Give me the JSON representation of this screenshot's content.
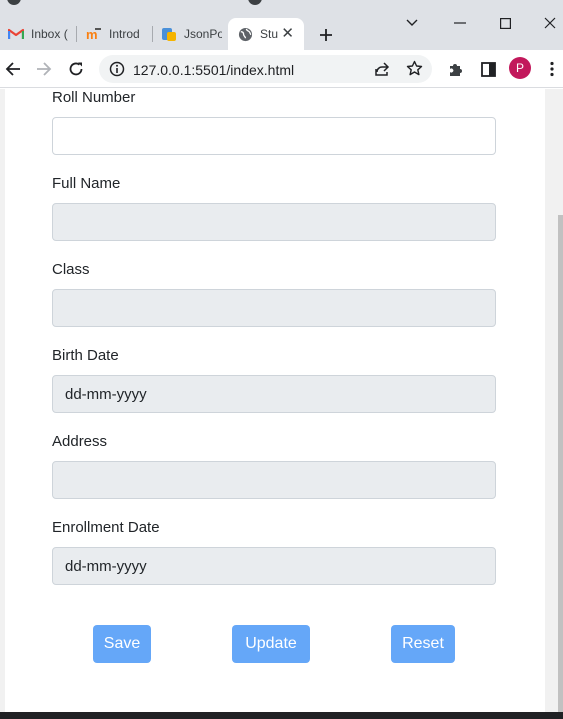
{
  "browser": {
    "tabs": [
      {
        "title": "Inbox (",
        "icon": "gmail-icon"
      },
      {
        "title": "Introd",
        "icon": "moodle-icon"
      },
      {
        "title": "JsonPo",
        "icon": "jsonpowerdb-icon"
      },
      {
        "title": "Stu",
        "icon": "globe-icon",
        "active": true
      }
    ],
    "url": "127.0.0.1:5501/index.html",
    "profile_initial": "P",
    "colors": {
      "profile": "#c2185b",
      "tabstrip": "#dee1e6"
    }
  },
  "form": {
    "fields": [
      {
        "label": "Roll Number",
        "value": "",
        "editable": true
      },
      {
        "label": "Full Name",
        "value": "",
        "editable": false
      },
      {
        "label": "Class",
        "value": "",
        "editable": false
      },
      {
        "label": "Birth Date",
        "value": "dd-mm-yyyy",
        "editable": false
      },
      {
        "label": "Address",
        "value": "",
        "editable": false
      },
      {
        "label": "Enrollment Date",
        "value": "dd-mm-yyyy",
        "editable": false
      }
    ],
    "buttons": {
      "save": "Save",
      "update": "Update",
      "reset": "Reset"
    },
    "colors": {
      "button": "#65a7f8",
      "disabled_field": "#e9ecef"
    }
  }
}
